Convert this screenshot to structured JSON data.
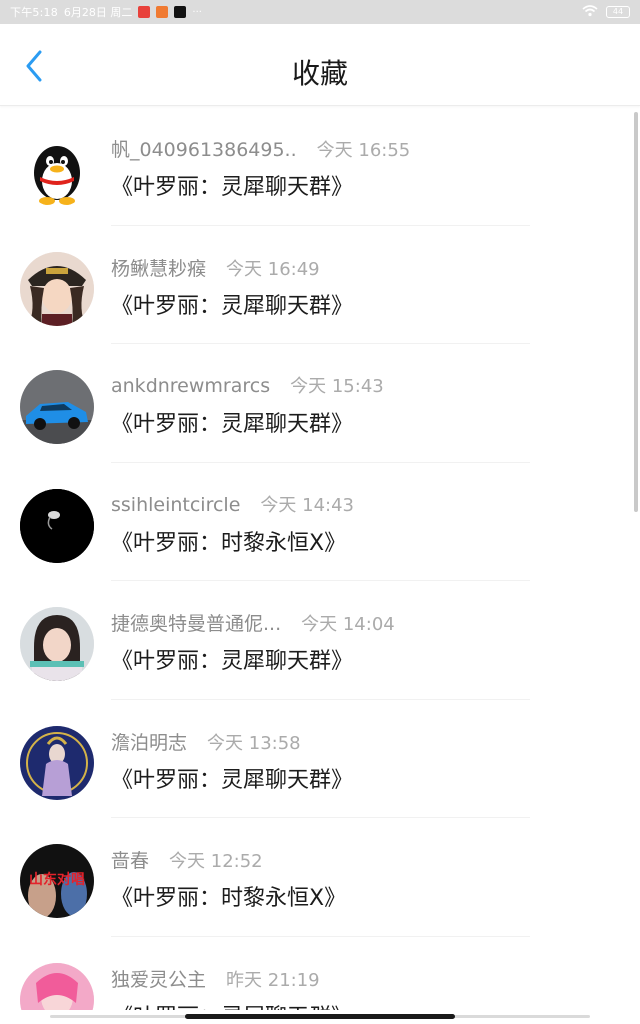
{
  "status_bar": {
    "time": "下午5:18",
    "date": "6月28日 周二",
    "more": "···",
    "battery": "44"
  },
  "header": {
    "title": "收藏"
  },
  "items": [
    {
      "sender": "帆_040961386495..",
      "time": "今天 16:55",
      "message": "《叶罗丽：灵犀聊天群》"
    },
    {
      "sender": "杨鳅慧耖瘊",
      "time": "今天 16:49",
      "message": "《叶罗丽：灵犀聊天群》"
    },
    {
      "sender": "ankdnrewmrarcs",
      "time": "今天 15:43",
      "message": "《叶罗丽：灵犀聊天群》"
    },
    {
      "sender": "ssihleintcircle",
      "time": "今天 14:43",
      "message": "《叶罗丽：时黎永恒X》"
    },
    {
      "sender": "捷德奥特曼普通伲...",
      "time": "今天 14:04",
      "message": "《叶罗丽：灵犀聊天群》"
    },
    {
      "sender": "澹泊明志",
      "time": "今天 13:58",
      "message": "《叶罗丽：灵犀聊天群》"
    },
    {
      "sender": "啬春",
      "time": "今天 12:52",
      "message": "《叶罗丽：时黎永恒X》"
    },
    {
      "sender": "独爱灵公主",
      "time": "昨天 21:19",
      "message": "《叶罗丽：灵犀聊天群》"
    }
  ],
  "avatar_text": {
    "item7": "山东对唱"
  },
  "colors": {
    "accent": "#2b9cf2",
    "status_bar_bg": "#dcdcdc"
  }
}
